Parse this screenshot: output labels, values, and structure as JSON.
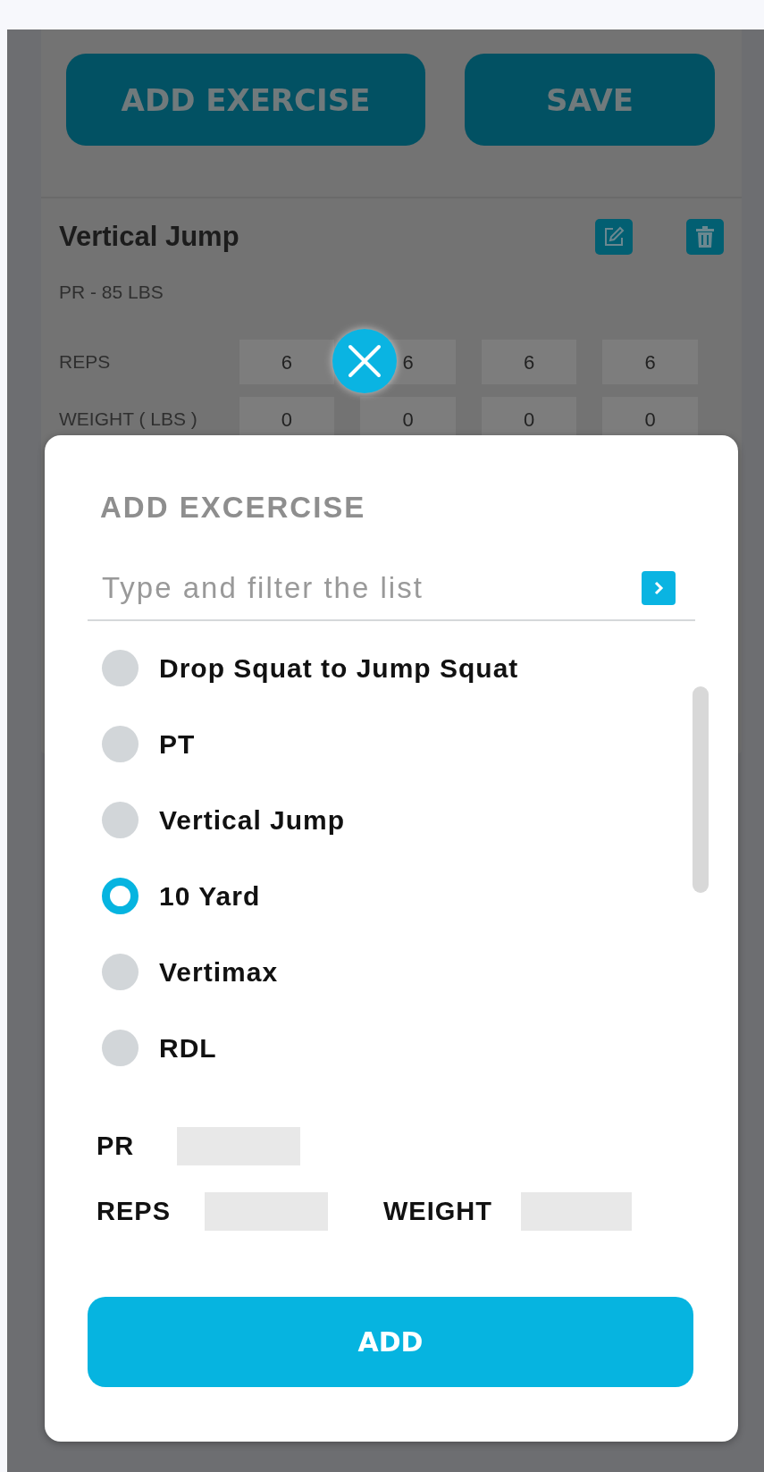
{
  "background": {
    "buttons": [
      {
        "label": "ADD EXERCISE"
      },
      {
        "label": "SAVE"
      }
    ],
    "exercise": {
      "title": "Vertical Jump",
      "pr": "PR - 85 LBS",
      "rows": [
        {
          "label": "REPS",
          "values": [
            "6",
            "6",
            "6",
            "6"
          ]
        },
        {
          "label": "WEIGHT ( LBS )",
          "values": [
            "0",
            "0",
            "0",
            "0"
          ]
        }
      ]
    }
  },
  "modal": {
    "title": "ADD EXCERCISE",
    "filter": {
      "placeholder": "Type and filter the list"
    },
    "options": [
      {
        "label": "Drop Squat to Jump Squat",
        "selected": false
      },
      {
        "label": "PT",
        "selected": false
      },
      {
        "label": "Vertical Jump",
        "selected": false
      },
      {
        "label": "10 Yard",
        "selected": true
      },
      {
        "label": "Vertimax",
        "selected": false
      },
      {
        "label": "RDL",
        "selected": false
      }
    ],
    "pr_label": "PR",
    "reps_label": "REPS",
    "weight_label": "WEIGHT",
    "add_button": "ADD"
  }
}
